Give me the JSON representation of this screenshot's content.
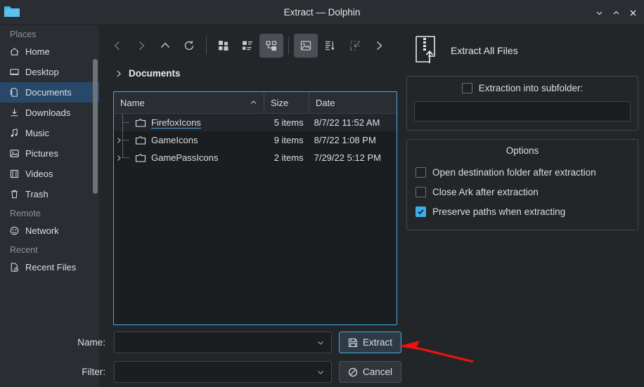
{
  "window": {
    "title": "Extract — Dolphin",
    "icon": "folder-icon",
    "buttons": {
      "minimize": "minimize-icon",
      "maximize": "maximize-icon",
      "close": "close-icon"
    }
  },
  "sidebar": {
    "groups": [
      {
        "label": "Places",
        "items": [
          {
            "label": "Home",
            "icon": "home-icon",
            "selected": false
          },
          {
            "label": "Desktop",
            "icon": "desktop-icon",
            "selected": false
          },
          {
            "label": "Documents",
            "icon": "documents-icon",
            "selected": true
          },
          {
            "label": "Downloads",
            "icon": "downloads-icon",
            "selected": false
          },
          {
            "label": "Music",
            "icon": "music-icon",
            "selected": false
          },
          {
            "label": "Pictures",
            "icon": "pictures-icon",
            "selected": false
          },
          {
            "label": "Videos",
            "icon": "videos-icon",
            "selected": false
          },
          {
            "label": "Trash",
            "icon": "trash-icon",
            "selected": false
          }
        ]
      },
      {
        "label": "Remote",
        "items": [
          {
            "label": "Network",
            "icon": "network-icon",
            "selected": false
          }
        ]
      },
      {
        "label": "Recent",
        "items": [
          {
            "label": "Recent Files",
            "icon": "recent-files-icon",
            "selected": false
          }
        ]
      }
    ]
  },
  "toolbar": {
    "items": [
      {
        "name": "back-button",
        "icon": "chevron-left-icon",
        "state": "disabled"
      },
      {
        "name": "forward-button",
        "icon": "chevron-right-icon",
        "state": "disabled"
      },
      {
        "name": "up-button",
        "icon": "chevron-up-icon",
        "state": "normal"
      },
      {
        "name": "reload-button",
        "icon": "reload-icon",
        "state": "normal"
      },
      {
        "name": "icons-view-button",
        "icon": "grid-view-icon",
        "state": "normal"
      },
      {
        "name": "compact-view-button",
        "icon": "compact-view-icon",
        "state": "normal"
      },
      {
        "name": "details-view-button",
        "icon": "details-view-icon",
        "state": "active"
      },
      {
        "name": "preview-button",
        "icon": "image-preview-icon",
        "state": "active"
      },
      {
        "name": "sort-button",
        "icon": "sort-icon",
        "state": "normal"
      },
      {
        "name": "select-button",
        "icon": "selection-icon",
        "state": "disabled"
      },
      {
        "name": "more-button",
        "icon": "chevron-right-icon",
        "state": "normal"
      }
    ]
  },
  "breadcrumb": {
    "arrow_icon": "chevron-right-icon",
    "path": "Documents"
  },
  "filelist": {
    "columns": [
      {
        "key": "name",
        "label": "Name",
        "sorted": true,
        "sort_icon": "chevron-up-icon"
      },
      {
        "key": "size",
        "label": "Size",
        "sorted": false
      },
      {
        "key": "date",
        "label": "Date",
        "sorted": false
      }
    ],
    "rows": [
      {
        "name": "FirefoxIcons",
        "size": "5 items",
        "date": "8/7/22 11:52 AM",
        "expandable": false,
        "hover": true,
        "icon": "folder-icon"
      },
      {
        "name": "GameIcons",
        "size": "9 items",
        "date": "8/7/22 1:08 PM",
        "expandable": true,
        "hover": false,
        "icon": "folder-icon"
      },
      {
        "name": "GamePassIcons",
        "size": "2 items",
        "date": "7/29/22 5:12 PM",
        "expandable": true,
        "hover": false,
        "icon": "folder-icon"
      }
    ]
  },
  "right_panel": {
    "header": {
      "icon": "extract-archive-icon",
      "title": "Extract All Files"
    },
    "subfolder_group": {
      "checkbox_label": "Extraction into subfolder:",
      "checked": false,
      "input_value": "",
      "input_placeholder": ""
    },
    "options_group": {
      "title": "Options",
      "options": [
        {
          "label": "Open destination folder after extraction",
          "checked": false
        },
        {
          "label": "Close Ark after extraction",
          "checked": false
        },
        {
          "label": "Preserve paths when extracting",
          "checked": true
        }
      ]
    }
  },
  "bottom": {
    "name_label": "Name:",
    "name_value": "",
    "name_placeholder": "",
    "filter_label": "Filter:",
    "filter_value": "",
    "filter_placeholder": "",
    "extract_button": {
      "label": "Extract",
      "icon": "save-icon"
    },
    "cancel_button": {
      "label": "Cancel",
      "icon": "cancel-icon"
    }
  },
  "annotation": {
    "arrow_color": "#ee1111",
    "points_to": "extract-button"
  },
  "colors": {
    "window_bg": "#232629",
    "panel_bg": "#2a2e32",
    "view_bg": "#1b1e21",
    "accent": "#3daee9",
    "selection": "#28486a",
    "text": "#dcdfe2",
    "muted_text": "#8d9399"
  }
}
